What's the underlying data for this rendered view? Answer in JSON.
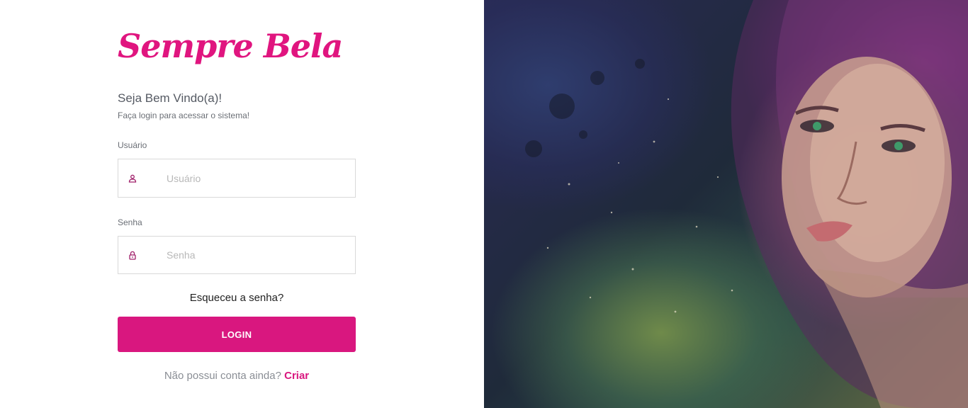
{
  "brand": {
    "name": "Sempre Bela"
  },
  "header": {
    "welcome": "Seja Bem Vindo(a)!",
    "subtitle": "Faça login para acessar o sistema!"
  },
  "form": {
    "username": {
      "label": "Usuário",
      "placeholder": "Usuário",
      "value": "",
      "icon": "user-icon"
    },
    "password": {
      "label": "Senha",
      "placeholder": "Senha",
      "value": "",
      "icon": "lock-icon"
    },
    "forgot_label": "Esqueceu a senha?",
    "login_label": "LOGIN"
  },
  "signup": {
    "prompt": "Não possui conta ainda?",
    "link_label": "Criar"
  },
  "colors": {
    "accent": "#d9177f",
    "brand": "#e0157f",
    "text": "#555a63",
    "muted": "#8a8e95"
  },
  "hero": {
    "description_icon": "portrait-artwork"
  }
}
